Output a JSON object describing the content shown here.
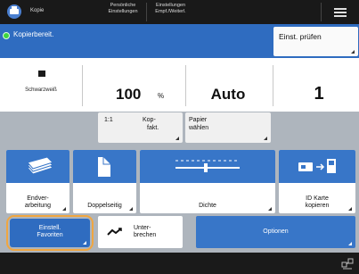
{
  "topbar": {
    "app_label": "Kopie",
    "personal_settings_label": "Persönliche Einstellungen",
    "receiver_settings_label": "Einstellungen Empf./Weiterl."
  },
  "status": {
    "text": "Kopierbereit.",
    "check_button_label": "Einst. prüfen"
  },
  "values": {
    "color_mode": "Schwarzweiß",
    "zoom_value": "100",
    "zoom_unit": "%",
    "paper": "Auto",
    "copies": "1"
  },
  "mid_buttons": {
    "ratio_label": "1:1",
    "copy_ratio_label_line1": "Kop-",
    "copy_ratio_label_line2": "fakt.",
    "paper_select_line1": "Papier",
    "paper_select_line2": "wählen"
  },
  "tiles": [
    {
      "line1": "Endver-",
      "line2": "arbeitung",
      "icon": "finishing-icon"
    },
    {
      "line1": "",
      "line2": "Doppelseitig",
      "icon": "two-sided-icon"
    },
    {
      "line1": "",
      "line2": "Dichte",
      "icon": "density-slider-icon"
    },
    {
      "line1": "ID Karte",
      "line2": "kopieren",
      "icon": "id-card-copy-icon"
    }
  ],
  "bottom": {
    "favorites_line1": "Einstell.",
    "favorites_line2": "Favoriten",
    "interrupt_line1": "Unter-",
    "interrupt_line2": "brechen",
    "options_label": "Optionen"
  },
  "colors": {
    "status_blue": "#2f6cc0",
    "tile_blue": "#3876c8",
    "highlight_orange": "#f0a640",
    "ready_green": "#3fd43f"
  }
}
